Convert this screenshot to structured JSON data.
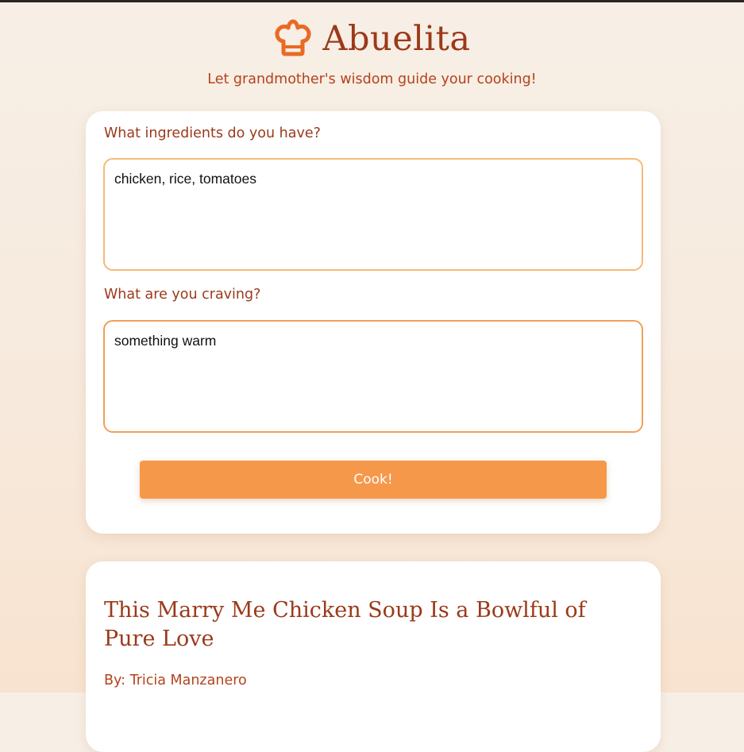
{
  "app": {
    "title": "Abuelita",
    "tagline": "Let grandmother's wisdom guide your cooking!",
    "logo_icon": "chef-hat-icon",
    "brand_color": "#9a3a1a",
    "accent_color": "#f6984a"
  },
  "form": {
    "ingredients_label": "What ingredients do you have?",
    "ingredients_value": "chicken, rice, tomatoes",
    "craving_label": "What are you craving?",
    "craving_value": "something warm",
    "submit_label": "Cook!"
  },
  "recipe": {
    "title": "This Marry Me Chicken Soup Is a Bowlful of Pure Love",
    "author_prefix": "By:",
    "author_name": "Tricia Manzanero"
  }
}
